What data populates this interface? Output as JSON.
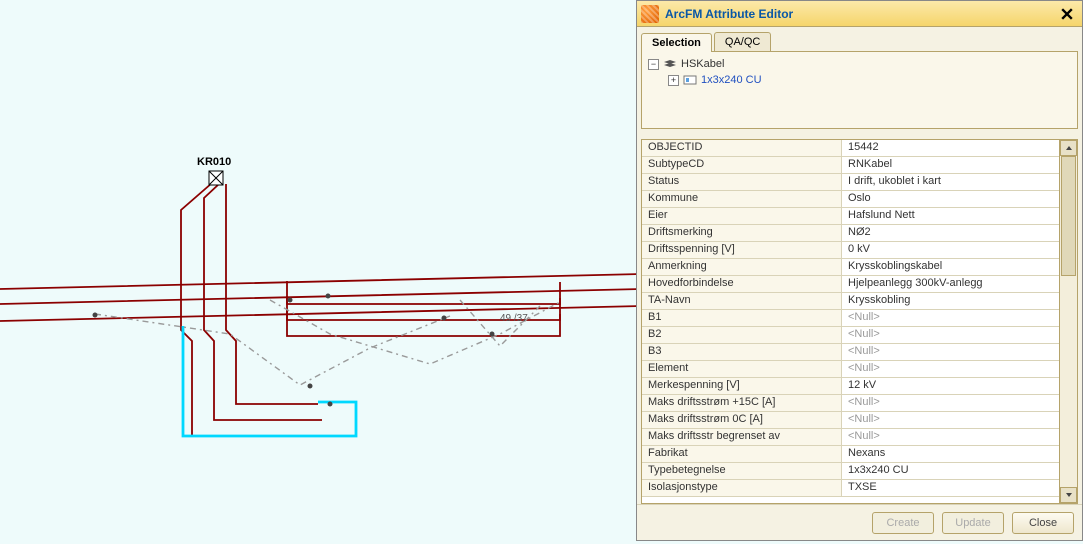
{
  "map": {
    "labels": {
      "kr010": "KR010",
      "ref": "49 /37"
    }
  },
  "panel": {
    "title": "ArcFM Attribute Editor",
    "tabs": [
      {
        "id": "selection",
        "label": "Selection",
        "active": true
      },
      {
        "id": "qaqc",
        "label": "QA/QC",
        "active": false
      }
    ],
    "tree": {
      "root": {
        "label": "HSKabel",
        "expanded": true
      },
      "child": {
        "label": "1x3x240 CU",
        "expanded": false
      }
    },
    "attributes": [
      {
        "key": "OBJECTID",
        "value": "15442"
      },
      {
        "key": "SubtypeCD",
        "value": "RNKabel"
      },
      {
        "key": "Status",
        "value": "I drift, ukoblet i kart"
      },
      {
        "key": "Kommune",
        "value": "Oslo"
      },
      {
        "key": "Eier",
        "value": "Hafslund Nett"
      },
      {
        "key": "Driftsmerking",
        "value": "NØ2"
      },
      {
        "key": "Driftsspenning [V]",
        "value": "0 kV"
      },
      {
        "key": "Anmerkning",
        "value": "Krysskoblingskabel"
      },
      {
        "key": "Hovedforbindelse",
        "value": "Hjelpeanlegg 300kV-anlegg"
      },
      {
        "key": "TA-Navn",
        "value": "Krysskobling"
      },
      {
        "key": "B1",
        "value": "<Null>",
        "null": true
      },
      {
        "key": "B2",
        "value": "<Null>",
        "null": true
      },
      {
        "key": "B3",
        "value": "<Null>",
        "null": true
      },
      {
        "key": "Element",
        "value": "<Null>",
        "null": true
      },
      {
        "key": "Merkespenning [V]",
        "value": "12 kV"
      },
      {
        "key": "Maks driftsstrøm +15C [A]",
        "value": "<Null>",
        "null": true
      },
      {
        "key": "Maks driftsstrøm 0C [A]",
        "value": "<Null>",
        "null": true
      },
      {
        "key": "Maks driftsstr begrenset av",
        "value": "<Null>",
        "null": true
      },
      {
        "key": "Fabrikat",
        "value": "Nexans"
      },
      {
        "key": "Typebetegnelse",
        "value": "1x3x240 CU"
      },
      {
        "key": "Isolasjonstype",
        "value": "TXSE"
      }
    ],
    "buttons": {
      "create": "Create",
      "update": "Update",
      "close": "Close"
    }
  }
}
